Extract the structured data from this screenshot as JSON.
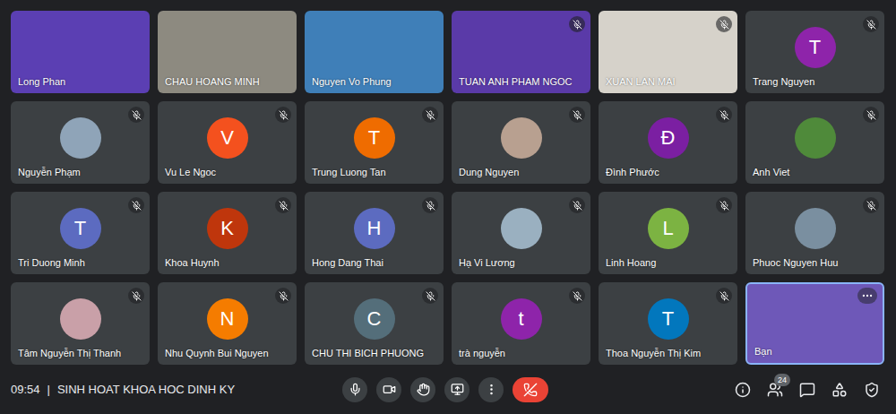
{
  "meeting": {
    "time": "09:54",
    "separator": "|",
    "title": "SINH HOAT KHOA HOC DINH KY"
  },
  "participants": [
    {
      "name": "Long Phan",
      "kind": "video",
      "muted": false,
      "color": "#5b3fb3",
      "letter": "",
      "highlighted": false,
      "more": false
    },
    {
      "name": "CHAU HOANG MINH",
      "kind": "video",
      "muted": false,
      "color": "#8d8a80",
      "letter": "",
      "highlighted": false,
      "more": false
    },
    {
      "name": "Nguyen Vo Phung",
      "kind": "video",
      "muted": false,
      "color": "#3f7fb8",
      "letter": "",
      "highlighted": false,
      "more": false
    },
    {
      "name": "TUAN ANH PHAM NGOC",
      "kind": "video",
      "muted": true,
      "color": "#5a3aa8",
      "letter": "",
      "highlighted": false,
      "more": false
    },
    {
      "name": "XUAN LAN MAI",
      "kind": "video",
      "muted": true,
      "color": "#d6d2ca",
      "letter": "",
      "highlighted": false,
      "more": false
    },
    {
      "name": "Trang Nguyen",
      "kind": "letter",
      "muted": true,
      "color": "#8e24aa",
      "letter": "T",
      "highlighted": false,
      "more": false
    },
    {
      "name": "Nguyễn Phạm",
      "kind": "photo",
      "muted": true,
      "color": "#8fa4b8",
      "letter": "",
      "highlighted": false,
      "more": false
    },
    {
      "name": "Vu Le Ngoc",
      "kind": "letter",
      "muted": true,
      "color": "#f4511e",
      "letter": "V",
      "highlighted": false,
      "more": false
    },
    {
      "name": "Trung Luong Tan",
      "kind": "letter",
      "muted": true,
      "color": "#ef6c00",
      "letter": "T",
      "highlighted": false,
      "more": false
    },
    {
      "name": "Dung Nguyen",
      "kind": "photo",
      "muted": true,
      "color": "#b8a090",
      "letter": "",
      "highlighted": false,
      "more": false
    },
    {
      "name": "Đình Phước",
      "kind": "letter",
      "muted": true,
      "color": "#7b1fa2",
      "letter": "Đ",
      "highlighted": false,
      "more": false
    },
    {
      "name": "Anh Viet",
      "kind": "photo",
      "muted": true,
      "color": "#4f8a3a",
      "letter": "",
      "highlighted": false,
      "more": false
    },
    {
      "name": "Tri Duong Minh",
      "kind": "letter",
      "muted": true,
      "color": "#5c6bc0",
      "letter": "T",
      "highlighted": false,
      "more": false
    },
    {
      "name": "Khoa Huynh",
      "kind": "letter",
      "muted": true,
      "color": "#bf360c",
      "letter": "K",
      "highlighted": false,
      "more": false
    },
    {
      "name": "Hong Dang Thai",
      "kind": "letter",
      "muted": true,
      "color": "#5c6bc0",
      "letter": "H",
      "highlighted": false,
      "more": false
    },
    {
      "name": "Hạ Vi Lương",
      "kind": "photo",
      "muted": true,
      "color": "#9ab0c0",
      "letter": "",
      "highlighted": false,
      "more": false
    },
    {
      "name": "Linh Hoang",
      "kind": "letter",
      "muted": true,
      "color": "#7cb342",
      "letter": "L",
      "highlighted": false,
      "more": false
    },
    {
      "name": "Phuoc Nguyen Huu",
      "kind": "photo",
      "muted": true,
      "color": "#7a8fa0",
      "letter": "",
      "highlighted": false,
      "more": false
    },
    {
      "name": "Tâm Nguyễn Thị Thanh",
      "kind": "photo",
      "muted": true,
      "color": "#c9a0a8",
      "letter": "",
      "highlighted": false,
      "more": false
    },
    {
      "name": "Nhu Quynh Bui Nguyen",
      "kind": "letter",
      "muted": true,
      "color": "#f57c00",
      "letter": "N",
      "highlighted": false,
      "more": false
    },
    {
      "name": "CHU THI BICH PHUONG",
      "kind": "letter",
      "muted": true,
      "color": "#546e7a",
      "letter": "C",
      "highlighted": false,
      "more": false
    },
    {
      "name": "trà nguyễn",
      "kind": "letter",
      "muted": true,
      "color": "#8e24aa",
      "letter": "t",
      "highlighted": false,
      "more": false
    },
    {
      "name": "Thoa Nguyễn Thị Kim",
      "kind": "letter",
      "muted": true,
      "color": "#0277bd",
      "letter": "T",
      "highlighted": false,
      "more": false
    },
    {
      "name": "Bạn",
      "kind": "video",
      "muted": false,
      "color": "#6e58b8",
      "letter": "",
      "highlighted": true,
      "more": true
    }
  ],
  "controls": {
    "mic_on": true,
    "camera_on": true
  },
  "people_count": "24"
}
